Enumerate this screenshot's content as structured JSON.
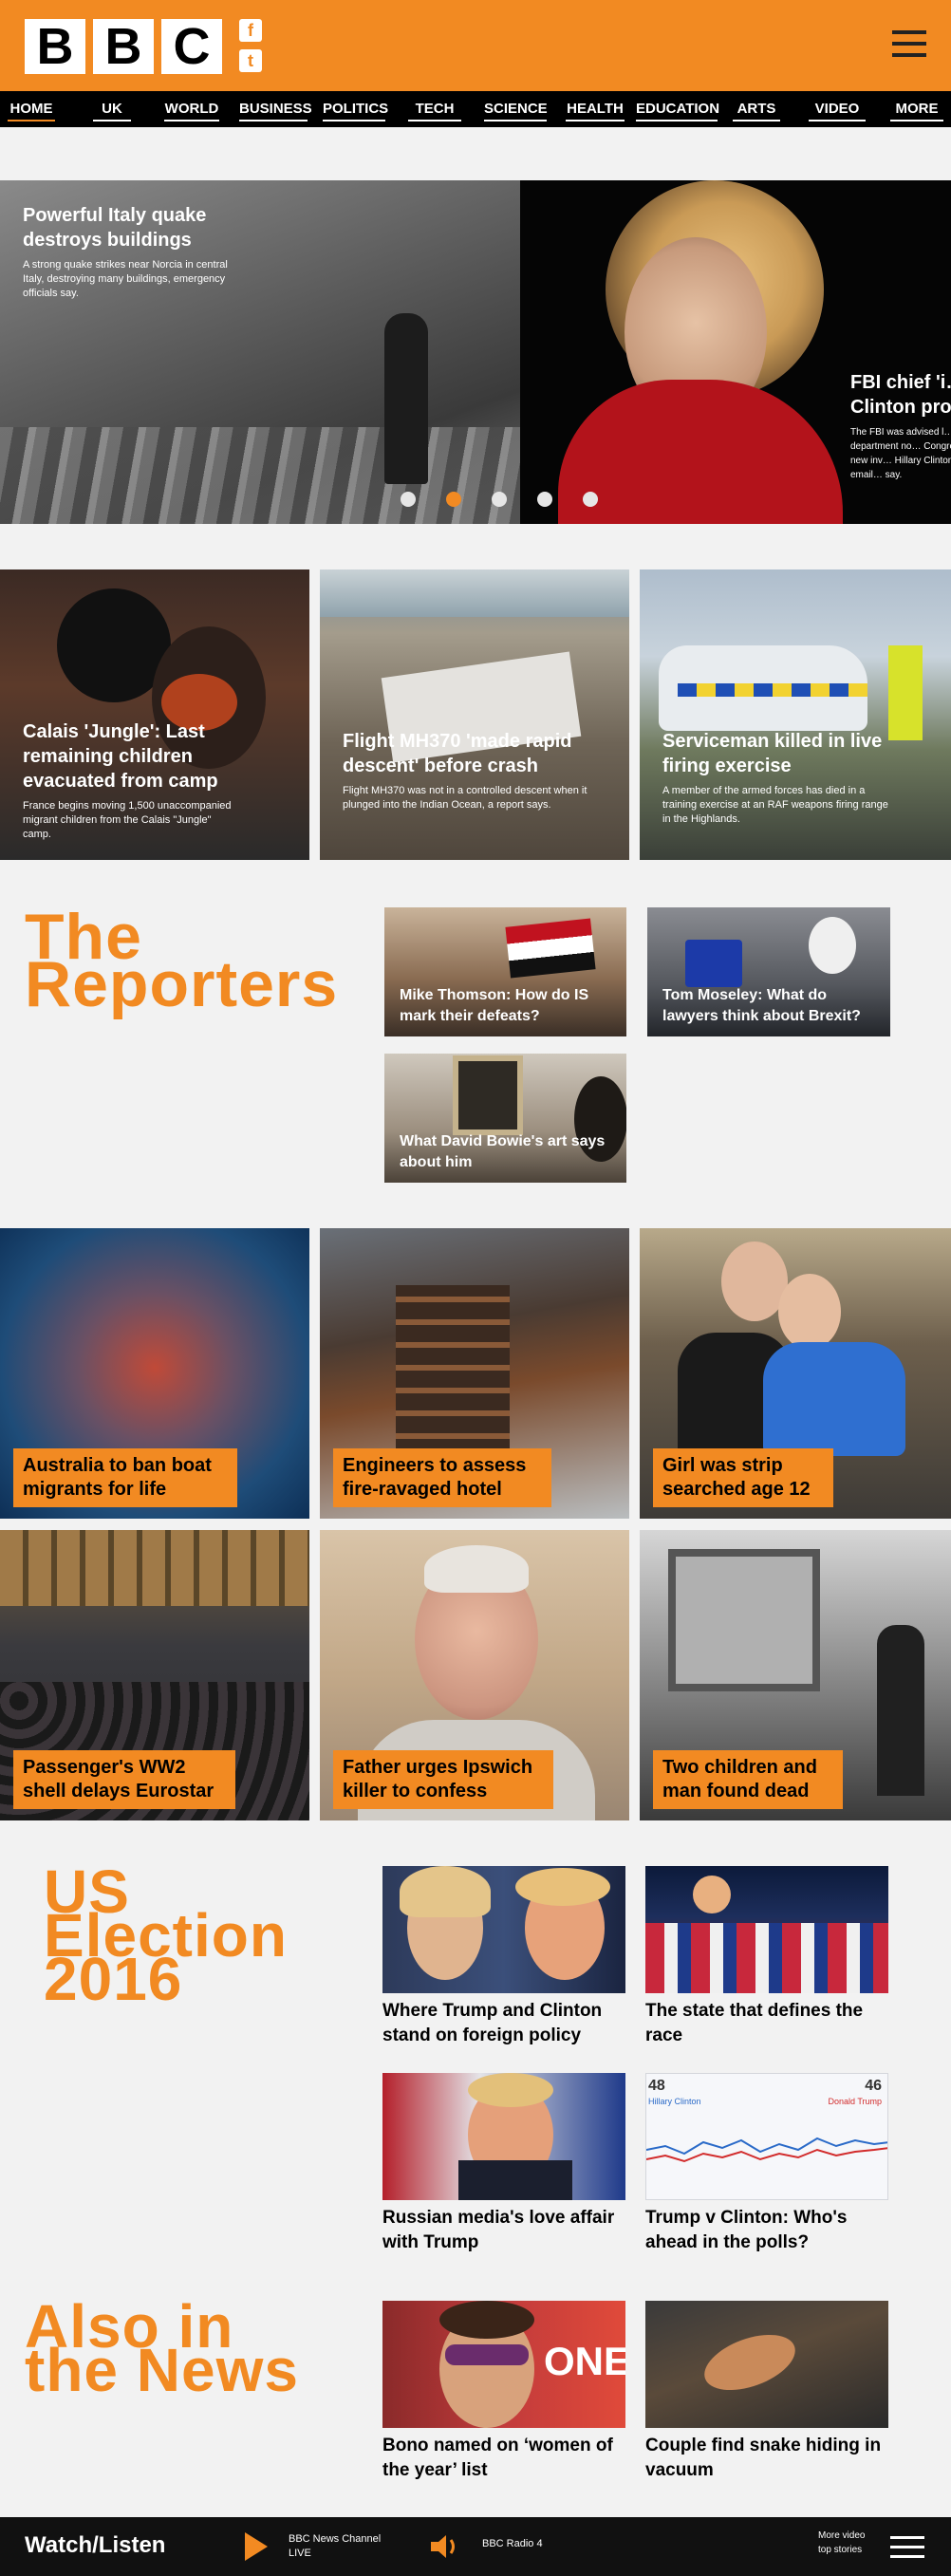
{
  "brand": {
    "logo_letters": [
      "B",
      "B",
      "C"
    ],
    "social": [
      "f",
      "t"
    ],
    "accent_color": "#f28a22"
  },
  "nav": [
    "HOME",
    "UK",
    "WORLD",
    "BUSINESS",
    "POLITICS",
    "TECH",
    "SCIENCE",
    "HEALTH",
    "EDUCATION",
    "ARTS",
    "VIDEO",
    "MORE"
  ],
  "carousel": {
    "slide1": {
      "title": "Powerful Italy quake destroys buildings",
      "summary": "A strong quake strikes near Norcia in central Italy, destroying many buildings, emergency officials say."
    },
    "slide2": {
      "title": "FBI chief 'i… Clinton pro…",
      "summary": "The FBI was advised l… justice department no… Congress of a new inv… Hillary Clinton's email… say."
    },
    "dots": 5,
    "active_dot": 2
  },
  "top_stories": [
    {
      "title": "Calais 'Jungle': Last remaining children evacuated from camp",
      "summary": "France begins moving 1,500 unaccompanied migrant children from the Calais \"Jungle\" camp."
    },
    {
      "title": "Flight MH370 'made rapid descent' before crash",
      "summary": "Flight MH370 was not in a controlled descent when it plunged into the Indian Ocean, a report says."
    },
    {
      "title": "Serviceman killed in live firing exercise",
      "summary": "A member of the armed forces has died in a training exercise at an RAF weapons firing range in the Highlands."
    }
  ],
  "reporters": {
    "heading_line1": "The",
    "heading_line2": "Reporters",
    "items": [
      "Mike Thomson: How do IS mark their defeats?",
      "Tom Moseley: What do lawyers think about Brexit?",
      "What David Bowie's art says about him"
    ]
  },
  "grid_stories": [
    "Australia to ban boat migrants for life",
    "Engineers to assess fire-ravaged hotel",
    "Girl was strip searched age 12",
    "Passenger's WW2 shell delays Eurostar",
    "Father urges Ipswich killer to confess",
    "Two children and man found dead"
  ],
  "election": {
    "heading_line1": "US",
    "heading_line2": "Election",
    "heading_line3": "2016",
    "items": [
      "Where Trump and Clinton stand on foreign policy",
      "The state that defines the race",
      "Russian media's love affair with Trump",
      "Trump v Clinton: Who's ahead in the polls?"
    ],
    "poll": {
      "clinton_pct": "48",
      "trump_pct": "46",
      "clinton_label": "Hillary Clinton",
      "trump_label": "Donald Trump"
    }
  },
  "also": {
    "heading_line1": "Also in",
    "heading_line2": "the News",
    "items": [
      "Bono named on ‘women of the year’ list",
      "Couple find snake hiding in vacuum"
    ],
    "bono_sign": "ONE"
  },
  "footer": {
    "watch": "Watch/Listen",
    "channel_line1": "BBC News Channel",
    "channel_line2": "LIVE",
    "radio": "BBC Radio 4",
    "more_line1": "More video",
    "more_line2": "top stories"
  }
}
